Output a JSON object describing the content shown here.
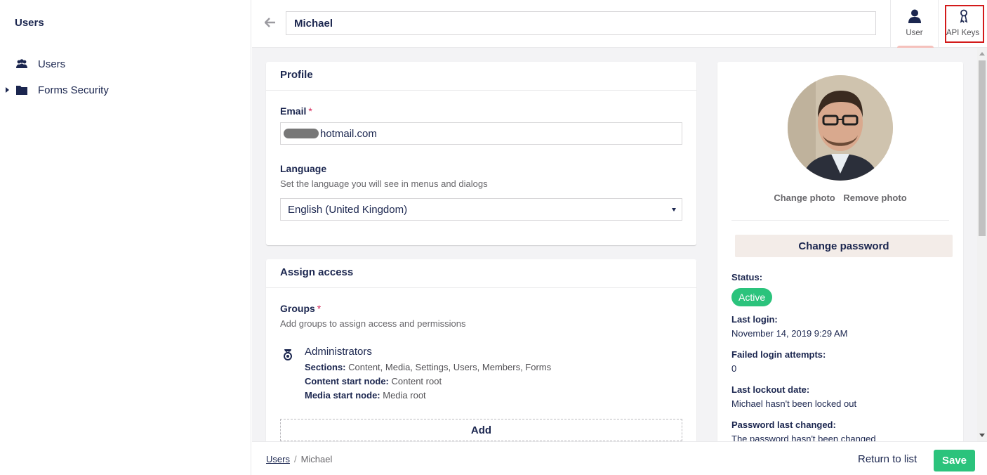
{
  "tree": {
    "title": "Users",
    "items": [
      {
        "label": "Users",
        "icon": "users-icon"
      },
      {
        "label": "Forms Security",
        "icon": "folder-icon"
      }
    ]
  },
  "header": {
    "name_value": "Michael",
    "buttons": [
      {
        "label": "User",
        "icon": "user-icon",
        "active": true
      },
      {
        "label": "API Keys",
        "icon": "key-icon",
        "highlighted": true
      }
    ]
  },
  "profile": {
    "title": "Profile",
    "email_label": "Email",
    "required_mark": "*",
    "email_value": "hotmail.com",
    "language_label": "Language",
    "language_desc": "Set the language you will see in menus and dialogs",
    "language_value": "English (United Kingdom)"
  },
  "assign": {
    "title": "Assign access",
    "groups_label": "Groups",
    "groups_desc": "Add groups to assign access and permissions",
    "group": {
      "name": "Administrators",
      "sections_label": "Sections:",
      "sections_value": "Content, Media, Settings, Users, Members, Forms",
      "content_label": "Content start node:",
      "content_value": "Content root",
      "media_label": "Media start node:",
      "media_value": "Media root"
    },
    "add_label": "Add"
  },
  "side": {
    "change_photo": "Change photo",
    "remove_photo": "Remove photo",
    "change_password": "Change password",
    "status_label": "Status:",
    "status_value": "Active",
    "last_login_label": "Last login:",
    "last_login_value": "November 14, 2019 9:29 AM",
    "failed_label": "Failed login attempts:",
    "failed_value": "0",
    "lockout_label": "Last lockout date:",
    "lockout_value": "Michael hasn't been locked out",
    "pw_changed_label": "Password last changed:",
    "pw_changed_value": "The password hasn't been changed"
  },
  "footer": {
    "crumb_root": "Users",
    "crumb_sep": "/",
    "crumb_current": "Michael",
    "return_label": "Return to list",
    "save_label": "Save"
  },
  "colors": {
    "primary_text": "#1b264f",
    "success": "#2bc37c",
    "highlight_border": "#d31a1a"
  }
}
